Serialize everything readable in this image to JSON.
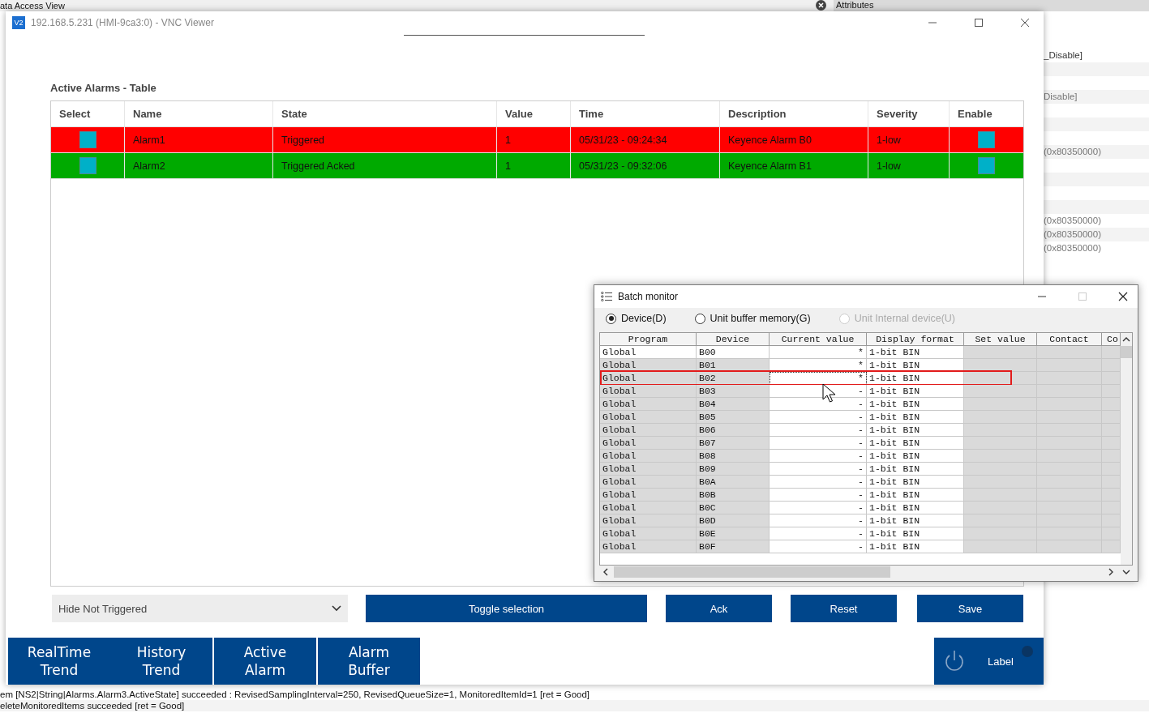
{
  "background": {
    "tab_title": "ata Access View",
    "panel_title": "Attributes",
    "right_texts": [
      "_Disable]",
      "Disable]",
      "(0x80350000)",
      "(0x80350000)",
      "(0x80350000)",
      "(0x80350000)"
    ],
    "log_lines": [
      "em [NS2|String|Alarms.Alarm3.ActiveState] succeeded : RevisedSamplingInterval=250, RevisedQueueSize=1, MonitoredItemId=1 [ret = Good]",
      "eleteMonitoredItems succeeded [ret = Good]"
    ]
  },
  "vnc_window": {
    "icon_text": "V2",
    "title": "192.168.5.231 (HMI-9ca3:0) - VNC Viewer"
  },
  "alarms": {
    "title": "Active Alarms - Table",
    "columns": [
      "Select",
      "Name",
      "State",
      "Value",
      "Time",
      "Description",
      "Severity",
      "Enable"
    ],
    "rows": [
      {
        "name": "Alarm1",
        "state": "Triggered",
        "value": "1",
        "time": "05/31/23 - 09:24:34",
        "description": "Keyence Alarm B0",
        "severity": "1-low",
        "color": "#ff0000"
      },
      {
        "name": "Alarm2",
        "state": "Triggered Acked",
        "value": "1",
        "time": "05/31/23 - 09:32:06",
        "description": "Keyence Alarm B1",
        "severity": "1-low",
        "color": "#00aa00"
      }
    ],
    "filter": {
      "value": "Hide Not Triggered"
    },
    "buttons": [
      "Toggle selection",
      "Ack",
      "Reset",
      "Save"
    ]
  },
  "nav": [
    {
      "items": [
        "RealTime Trend",
        "History Trend"
      ]
    },
    {
      "items": [
        "Active Alarm"
      ]
    },
    {
      "items": [
        "Alarm Buffer"
      ]
    }
  ],
  "power_button": {
    "label": "Label"
  },
  "batch_monitor": {
    "title": "Batch monitor",
    "radios": [
      {
        "label": "Device(D)",
        "selected": true,
        "disabled": false
      },
      {
        "label": "Unit buffer memory(G)",
        "selected": false,
        "disabled": false
      },
      {
        "label": "Unit Internal device(U)",
        "selected": false,
        "disabled": true
      }
    ],
    "columns": [
      "Program",
      "Device",
      "Current value",
      "Display format",
      "Set value",
      "Contact",
      "Co"
    ],
    "rows": [
      {
        "program": "Global",
        "device": "B00",
        "current": "*",
        "format": "1-bit BIN",
        "selected": true,
        "highlighted": false
      },
      {
        "program": "Global",
        "device": "B01",
        "current": "*",
        "format": "1-bit BIN",
        "selected": false,
        "highlighted": false
      },
      {
        "program": "Global",
        "device": "B02",
        "current": "*",
        "format": "1-bit BIN",
        "selected": false,
        "highlighted": true
      },
      {
        "program": "Global",
        "device": "B03",
        "current": "-",
        "format": "1-bit BIN",
        "selected": false,
        "highlighted": false
      },
      {
        "program": "Global",
        "device": "B04",
        "current": "-",
        "format": "1-bit BIN",
        "selected": false,
        "highlighted": false
      },
      {
        "program": "Global",
        "device": "B05",
        "current": "-",
        "format": "1-bit BIN",
        "selected": false,
        "highlighted": false
      },
      {
        "program": "Global",
        "device": "B06",
        "current": "-",
        "format": "1-bit BIN",
        "selected": false,
        "highlighted": false
      },
      {
        "program": "Global",
        "device": "B07",
        "current": "-",
        "format": "1-bit BIN",
        "selected": false,
        "highlighted": false
      },
      {
        "program": "Global",
        "device": "B08",
        "current": "-",
        "format": "1-bit BIN",
        "selected": false,
        "highlighted": false
      },
      {
        "program": "Global",
        "device": "B09",
        "current": "-",
        "format": "1-bit BIN",
        "selected": false,
        "highlighted": false
      },
      {
        "program": "Global",
        "device": "B0A",
        "current": "-",
        "format": "1-bit BIN",
        "selected": false,
        "highlighted": false
      },
      {
        "program": "Global",
        "device": "B0B",
        "current": "-",
        "format": "1-bit BIN",
        "selected": false,
        "highlighted": false
      },
      {
        "program": "Global",
        "device": "B0C",
        "current": "-",
        "format": "1-bit BIN",
        "selected": false,
        "highlighted": false
      },
      {
        "program": "Global",
        "device": "B0D",
        "current": "-",
        "format": "1-bit BIN",
        "selected": false,
        "highlighted": false
      },
      {
        "program": "Global",
        "device": "B0E",
        "current": "-",
        "format": "1-bit BIN",
        "selected": false,
        "highlighted": false
      },
      {
        "program": "Global",
        "device": "B0F",
        "current": "-",
        "format": "1-bit BIN",
        "selected": false,
        "highlighted": false
      }
    ]
  }
}
